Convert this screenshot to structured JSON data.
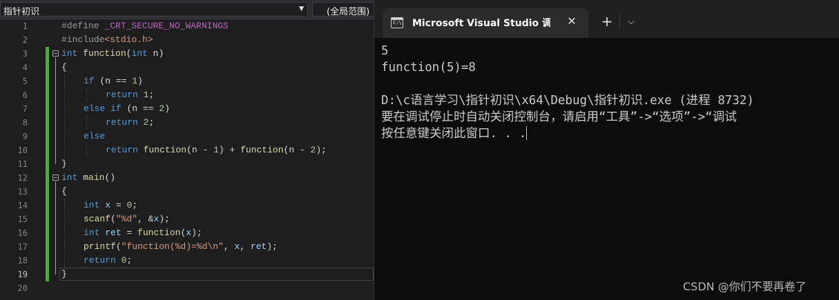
{
  "editor": {
    "scope_left": "指针初识",
    "scope_right": "(全局范围)",
    "current_line": 19,
    "lines": [
      {
        "n": "1"
      },
      {
        "n": "2"
      },
      {
        "n": "3"
      },
      {
        "n": "4"
      },
      {
        "n": "5"
      },
      {
        "n": "6"
      },
      {
        "n": "7"
      },
      {
        "n": "8"
      },
      {
        "n": "9"
      },
      {
        "n": "10"
      },
      {
        "n": "11"
      },
      {
        "n": "12"
      },
      {
        "n": "13"
      },
      {
        "n": "14"
      },
      {
        "n": "15"
      },
      {
        "n": "16"
      },
      {
        "n": "17"
      },
      {
        "n": "18"
      },
      {
        "n": "19"
      },
      {
        "n": "20"
      }
    ],
    "code": {
      "l1": {
        "a": "#define ",
        "b": "_CRT_SECURE_NO_WARNINGS"
      },
      "l2": {
        "a": "#include",
        "b": "<stdio.h>"
      },
      "l3": {
        "a": "int",
        "b": " ",
        "c": "function",
        "d": "(",
        "e": "int",
        "f": " n)"
      },
      "l4": "{",
      "l5": {
        "a": "if",
        "b": " (n == ",
        "c": "1",
        "d": ")"
      },
      "l6": {
        "a": "return",
        "b": " ",
        "c": "1",
        "d": ";"
      },
      "l7": {
        "a": "else",
        "b": " ",
        "c": "if",
        "d": " (n == ",
        "e": "2",
        "f": ")"
      },
      "l8": {
        "a": "return",
        "b": " ",
        "c": "2",
        "d": ";"
      },
      "l9": "else",
      "l10": {
        "a": "return",
        "b": " ",
        "c": "function",
        "d": "(n - ",
        "e": "1",
        "f": ") + ",
        "g": "function",
        "h": "(n - ",
        "i": "2",
        "j": ");"
      },
      "l11": "}",
      "l12": {
        "a": "int",
        "b": " ",
        "c": "main",
        "d": "()"
      },
      "l13": "{",
      "l14": {
        "a": "int",
        "b": " ",
        "c": "x",
        "d": " = ",
        "e": "0",
        "f": ";"
      },
      "l15": {
        "a": "scanf",
        "b": "(",
        "c": "\"%d\"",
        "d": ", &",
        "e": "x",
        "f": ");"
      },
      "l16": {
        "a": "int",
        "b": " ",
        "c": "ret",
        "d": " = ",
        "e": "function",
        "f": "(",
        "g": "x",
        "h": ");"
      },
      "l17": {
        "a": "printf",
        "b": "(",
        "c": "\"function(%d)=%d\\n\"",
        "d": ", ",
        "e": "x",
        "f": ", ",
        "g": "ret",
        "h": ");"
      },
      "l18": {
        "a": "return",
        "b": " ",
        "c": "0",
        "d": ";"
      },
      "l19": "}"
    }
  },
  "terminal": {
    "tab_title": "Microsoft Visual Studio 调试控制台",
    "close_glyph": "✕",
    "new_tab_glyph": "+",
    "dropdown_glyph": "⌵",
    "icon_glyph": "C:\\",
    "output": [
      "5",
      "function(5)=8",
      "",
      "D:\\c语言学习\\指针初识\\x64\\Debug\\指针初识.exe (进程 8732)",
      "要在调试停止时自动关闭控制台，请启用“工具”->“选项”->“调试",
      "按任意键关闭此窗口. . ."
    ]
  },
  "watermark": "CSDN @你们不要再卷了"
}
